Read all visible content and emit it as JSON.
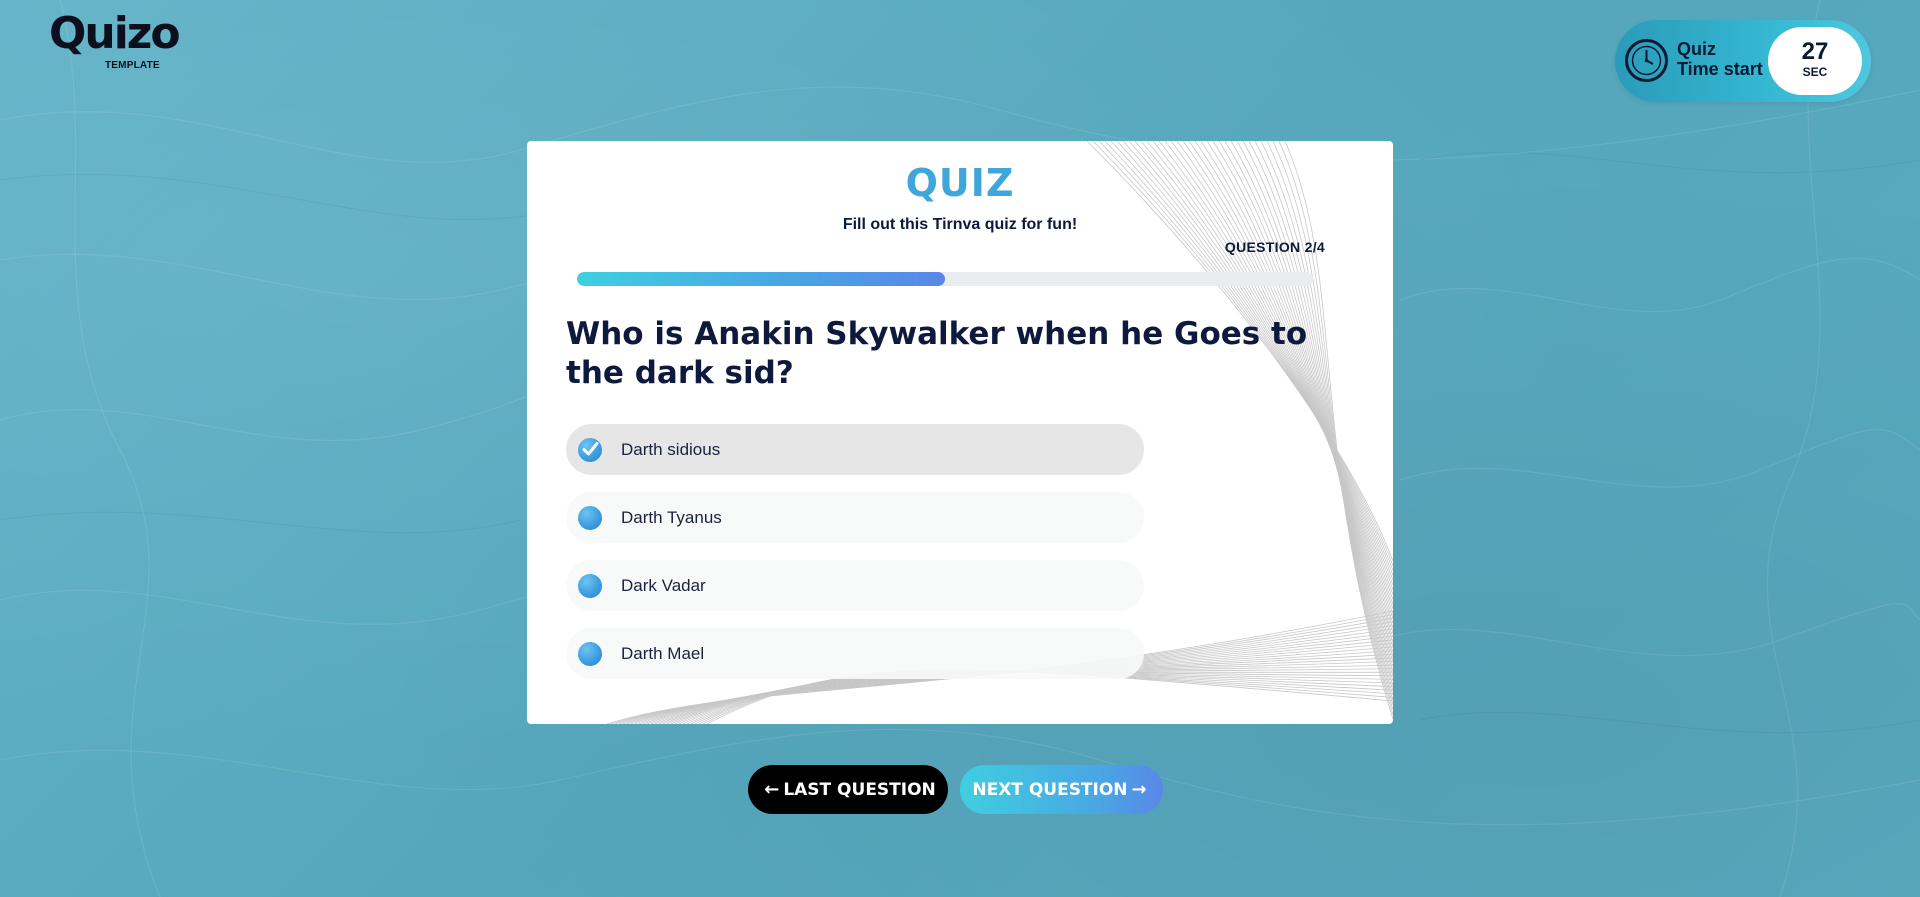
{
  "logo": {
    "word": "Quizo",
    "sub": "TEMPLATE"
  },
  "timer": {
    "label_line1": "Quiz",
    "label_line2": "Time start",
    "value": "27",
    "unit": "SEC",
    "icon": "clock-icon"
  },
  "card": {
    "title": "QUIZ",
    "subtitle": "Fill out this Tirnva quiz for fun!",
    "counter": "QUESTION 2/4",
    "progress_fraction": 0.5,
    "question": "Who is Anakin Skywalker when he Goes to the dark sid?",
    "options": [
      {
        "label": "Darth sidious",
        "selected": true
      },
      {
        "label": "Darth Tyanus",
        "selected": false
      },
      {
        "label": "Dark Vadar",
        "selected": false
      },
      {
        "label": "Darth Mael",
        "selected": false
      }
    ]
  },
  "nav": {
    "prev_label": "LAST QUESTION",
    "next_label": "NEXT QUESTION",
    "prev_icon": "arrow-left-icon",
    "next_icon": "arrow-right-icon"
  },
  "colors": {
    "background": "#5aaabf",
    "accent": "#3fa6dc",
    "text_dark": "#0e1a3d",
    "progress_start": "#3ed0df",
    "progress_end": "#5a86e8"
  }
}
